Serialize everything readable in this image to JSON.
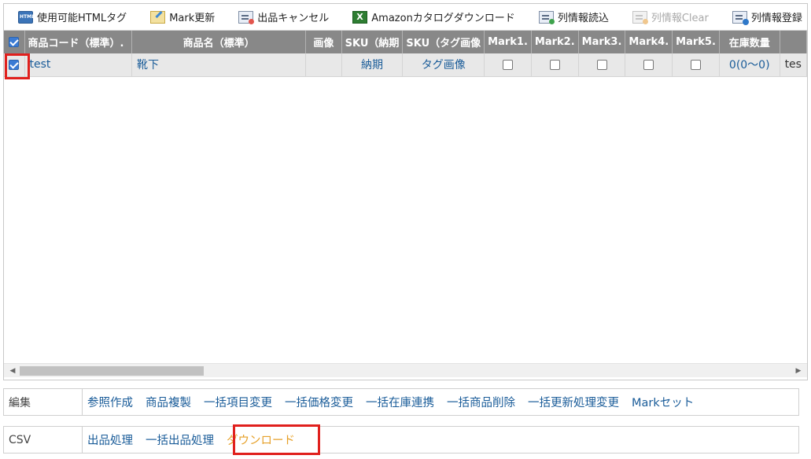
{
  "toolbar": {
    "buttons": [
      {
        "label": "使用可能HTMLタグ",
        "icon": "html-tag-icon"
      },
      {
        "label": "Mark更新",
        "icon": "mark-edit-icon"
      },
      {
        "label": "出品キャンセル",
        "icon": "listing-cancel-icon"
      },
      {
        "label": "Amazonカタログダウンロード",
        "icon": "excel-icon"
      },
      {
        "label": "列情報読込",
        "icon": "column-load-icon"
      },
      {
        "label": "列情報Clear",
        "icon": "column-clear-icon",
        "disabled": true
      },
      {
        "label": "列情報登録",
        "icon": "column-save-icon"
      }
    ]
  },
  "grid": {
    "columns": [
      "商品コード（標準）.",
      "商品名（標準）",
      "画像",
      "SKU（納期",
      "SKU（タグ画像",
      "Mark1.",
      "Mark2.",
      "Mark3.",
      "Mark4.",
      "Mark5.",
      "在庫数量",
      ""
    ],
    "header_checkbox_checked": true,
    "rows": [
      {
        "checked": true,
        "code": "test",
        "name": "靴下",
        "image": "",
        "sku_delivery": "納期",
        "sku_tag_image": "タグ画像",
        "marks": [
          false,
          false,
          false,
          false,
          false
        ],
        "stock": "0(0〜0)",
        "extra": "tes"
      }
    ]
  },
  "actions": {
    "edit": {
      "label": "編集",
      "links": [
        "参照作成",
        "商品複製",
        "一括項目変更",
        "一括価格変更",
        "一括在庫連携",
        "一括商品削除",
        "一括更新処理変更",
        "Markセット"
      ]
    },
    "csv": {
      "label": "CSV",
      "links": [
        "出品処理",
        "一括出品処理",
        "ダウンロード"
      ]
    }
  },
  "colors": {
    "header_bg": "#888888",
    "link": "#1a5c99",
    "active_link": "#e6a12a",
    "highlight": "#e0201d"
  }
}
